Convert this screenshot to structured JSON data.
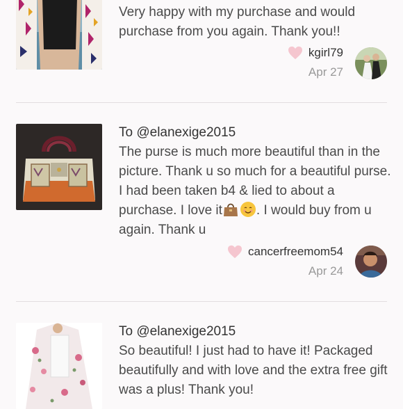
{
  "reviews": [
    {
      "title": "",
      "text": "Very happy with my purchase and would purchase from you again. Thank you!!",
      "username": "kgirl79",
      "date": "Apr 27"
    },
    {
      "title": "To @elanexige2015",
      "text_before": "The purse is much more beautiful than in the picture. Thank u so much for a beautiful purse. I had been taken b4 & lied to about a purchase. I love it",
      "text_after": ". I would buy from u again. Thank u",
      "emojis": [
        "handbag-emoji",
        "smiling-face-emoji"
      ],
      "username": "cancerfreemom54",
      "date": "Apr 24"
    },
    {
      "title": "To @elanexige2015",
      "text": "So beautiful! I just had to have it! Packaged beautifully and with love and the extra free gift was a plus! Thank you!"
    }
  ],
  "colors": {
    "background": "#fbf9fa",
    "heart": "#f5c6cf",
    "divider": "#e2dde0",
    "date": "#999999"
  }
}
